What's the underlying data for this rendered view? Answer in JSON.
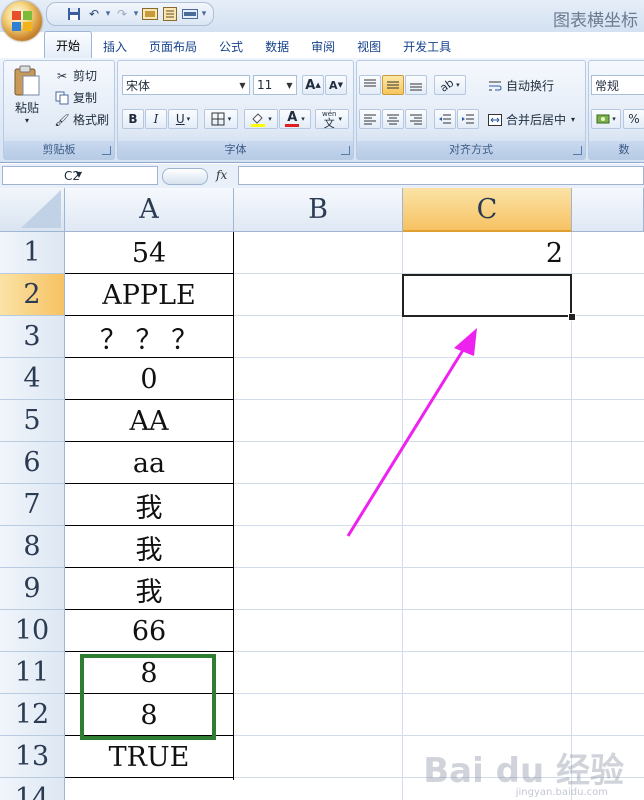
{
  "window": {
    "title": "图表横坐标"
  },
  "quick_access": {
    "undo_icon": "undo-icon",
    "redo_icon": "redo-icon",
    "save_icon": "save-icon"
  },
  "tabs": [
    "开始",
    "插入",
    "页面布局",
    "公式",
    "数据",
    "审阅",
    "视图",
    "开发工具"
  ],
  "active_tab": "开始",
  "ribbon": {
    "clipboard": {
      "paste": "粘贴",
      "cut": "剪切",
      "copy": "复制",
      "format_painter": "格式刷",
      "label": "剪贴板"
    },
    "font": {
      "font_name": "宋体",
      "font_size": "11",
      "bold": "B",
      "italic": "I",
      "underline": "U",
      "grow": "A",
      "shrink": "A",
      "font_color_glyph": "A",
      "phonetic": "wén",
      "phonetic_char": "文",
      "label": "字体"
    },
    "alignment": {
      "wrap_text": "自动换行",
      "merge_center": "合并后居中",
      "label": "对齐方式"
    },
    "number": {
      "format": "常规",
      "percent": "%",
      "label": "数"
    }
  },
  "formula_bar": {
    "name_box": "C2",
    "fx": "fx",
    "value": ""
  },
  "columns": [
    "A",
    "B",
    "C"
  ],
  "selected_column": "C",
  "rows": [
    "1",
    "2",
    "3",
    "4",
    "5",
    "6",
    "7",
    "8",
    "9",
    "10",
    "11",
    "12",
    "13",
    "14"
  ],
  "selected_row": "2",
  "cells": {
    "A": [
      "54",
      "APPLE",
      "？ ？ ？",
      "0",
      "AA",
      "aa",
      "我",
      "我",
      "我",
      "66",
      "8",
      "8",
      "TRUE"
    ],
    "C1": "2"
  },
  "watermark": {
    "text": "Bai du 经验",
    "sub": "jingyan.baidu.com"
  },
  "colors": {
    "accent_green": "#2e7d32",
    "arrow_magenta": "#ee22ee",
    "selected_header": "#f6c263"
  }
}
